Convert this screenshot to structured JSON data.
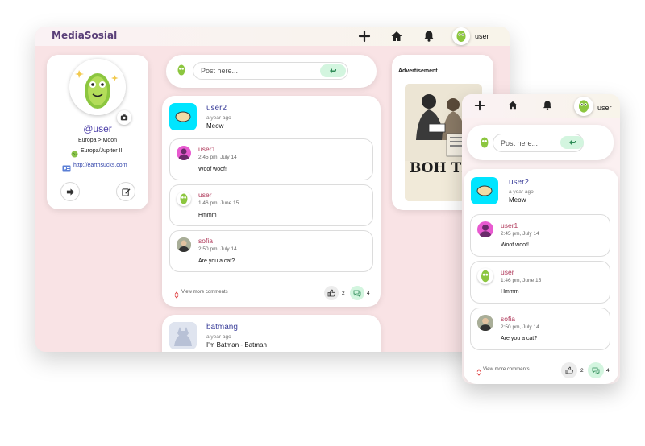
{
  "app": {
    "brand": "MediaSosial"
  },
  "nav": {
    "username": "user"
  },
  "profile": {
    "handle": "@user",
    "location": "Europa > Moon",
    "timezone": "Europa/Jupiter II",
    "website": "http://earthsucks.com"
  },
  "composer": {
    "placeholder": "Post here..."
  },
  "ad": {
    "title": "Advertisement",
    "image_text": "BOH TEA"
  },
  "posts": [
    {
      "author": "user2",
      "time": "a year ago",
      "text": "Meow",
      "comments": [
        {
          "author": "user1",
          "time": "2:45 pm, July 14",
          "text": "Woof woof!"
        },
        {
          "author": "user",
          "time": "1:46 pm, June 15",
          "text": "Hmmm"
        },
        {
          "author": "sofia",
          "time": "2:50 pm, July 14",
          "text": "Are you a cat?"
        }
      ],
      "view_more": "View more comments",
      "likes": "2",
      "comment_count": "4"
    },
    {
      "author": "batmang",
      "time": "a year ago",
      "text": "I'm Batman - Batman"
    }
  ],
  "colors": {
    "accent": "#3b3f9a",
    "background": "#f9e3e5",
    "send": "#d3f5df",
    "post_avatar": "#00e5ff",
    "comment_author": "#b03a5b"
  }
}
